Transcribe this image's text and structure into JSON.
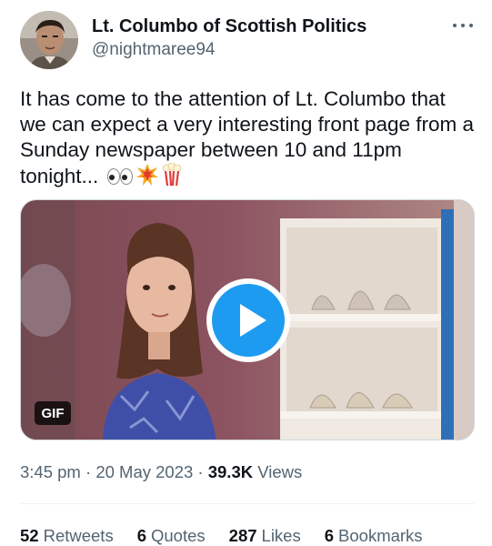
{
  "author": {
    "display_name": "Lt. Columbo of Scottish Politics",
    "handle": "@nightmaree94",
    "avatar_icon": "man-portrait-avatar"
  },
  "more_icon": "more-dots-icon",
  "tweet": {
    "text": "It has come to the attention of Lt. Columbo that we can expect a very interesting front page from a Sunday newspaper between 10 and 11pm tonight...",
    "emojis": [
      "eyes-emoji",
      "collision-emoji",
      "popcorn-emoji"
    ]
  },
  "media": {
    "type": "gif",
    "badge": "GIF",
    "play_icon": "play-icon"
  },
  "meta": {
    "time": "3:45 pm",
    "separator1": "·",
    "date": "20 May 2023",
    "separator2": "·",
    "views_count": "39.3K",
    "views_label": "Views"
  },
  "stats": [
    {
      "count": "52",
      "label": "Retweets"
    },
    {
      "count": "6",
      "label": "Quotes"
    },
    {
      "count": "287",
      "label": "Likes"
    },
    {
      "count": "6",
      "label": "Bookmarks"
    }
  ],
  "colors": {
    "accent": "#1d9bf0",
    "text_primary": "#0f1419",
    "text_secondary": "#536471"
  }
}
